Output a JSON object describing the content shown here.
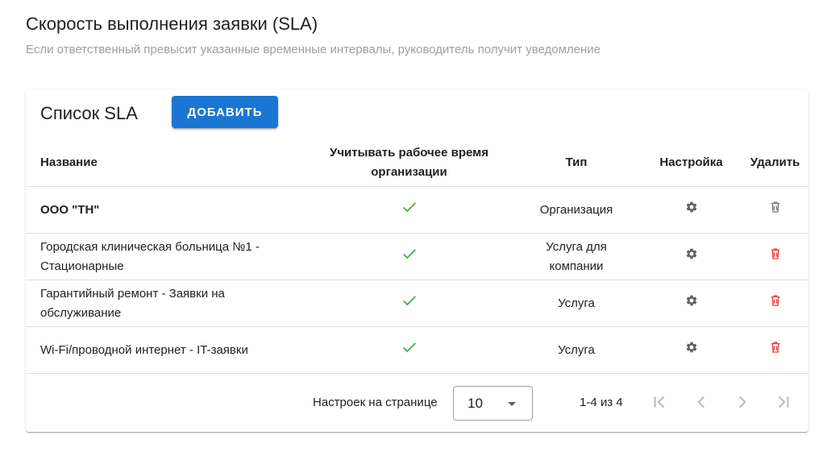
{
  "header": {
    "title": "Скорость выполнения заявки (SLA)",
    "subtitle": "Если ответственный превысит указанные временные интервалы, руководитель получит уведомление"
  },
  "card": {
    "title": "Список SLA",
    "add_label": "ДОБАВИТЬ"
  },
  "table": {
    "columns": {
      "name": "Название",
      "work_time": "Учитывать рабочее время организации",
      "type": "Тип",
      "settings": "Настройка",
      "delete": "Удалить"
    },
    "rows": [
      {
        "name": "ООО \"ТН\"",
        "work_time": true,
        "type": "Организация",
        "deletable": false
      },
      {
        "name": "Городская клиническая больница №1 - Стационарные",
        "work_time": true,
        "type": "Услуга для компании",
        "deletable": true
      },
      {
        "name": "Гарантийный ремонт - Заявки на обслуживание",
        "work_time": true,
        "type": "Услуга",
        "deletable": true
      },
      {
        "name": "Wi-Fi/проводной интернет - IT-заявки",
        "work_time": true,
        "type": "Услуга",
        "deletable": true
      }
    ]
  },
  "pagination": {
    "rows_per_page_label": "Настроек на странице",
    "rows_per_page": "10",
    "range": "1-4 из 4"
  },
  "colors": {
    "accent": "#1976d2",
    "check": "#4caf50",
    "delete_active": "#e53935",
    "delete_disabled": "#757575",
    "muted": "#9e9e9e"
  },
  "icons": {
    "check": "check-icon",
    "settings": "gear-icon",
    "delete": "trash-icon",
    "dropdown": "chevron-down-icon",
    "first": "first-page-icon",
    "prev": "chevron-left-icon",
    "next": "chevron-right-icon",
    "last": "last-page-icon"
  }
}
